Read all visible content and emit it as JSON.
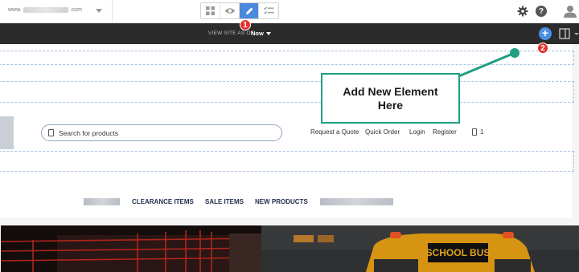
{
  "toolbar": {
    "site_url_prefix": "www.",
    "site_url_suffix": ".com",
    "modes": [
      {
        "name": "grid-icon",
        "active": false
      },
      {
        "name": "eye-icon",
        "active": false
      },
      {
        "name": "pencil-icon",
        "active": true
      },
      {
        "name": "checklist-icon",
        "active": false
      }
    ],
    "help_label": "?"
  },
  "viewbar": {
    "view_site_label": "VIEW SITE AS OF",
    "now_value": "Now",
    "add_label": "+"
  },
  "badges": {
    "first": "1",
    "second": "2"
  },
  "callout": {
    "text": "Add New Element Here"
  },
  "header": {
    "search_placeholder": "Search for products",
    "links": [
      "Request a Quote",
      "Quick Order",
      "Login",
      "Register"
    ],
    "cart_count": "1"
  },
  "nav": {
    "items": [
      "CLEARANCE ITEMS",
      "SALE ITEMS",
      "NEW PRODUCTS"
    ]
  },
  "hero": {
    "bus_sign": "SCHOOL BUS"
  },
  "colors": {
    "accent_blue": "#4a89dc",
    "badge_red": "#e3322b",
    "callout_green": "#1f9e83",
    "dark_bar": "#2b2b2b"
  }
}
